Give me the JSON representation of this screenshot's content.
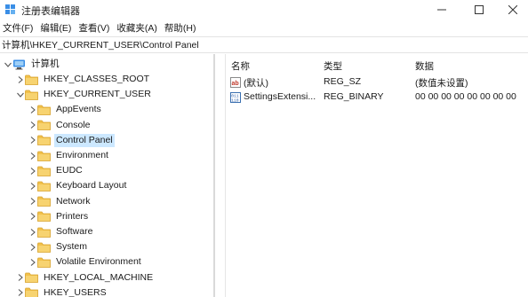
{
  "window": {
    "title": "注册表编辑器",
    "controls": {
      "minimize": "—",
      "maximize": "☐",
      "close": "✕"
    }
  },
  "menu": [
    "文件(F)",
    "编辑(E)",
    "查看(V)",
    "收藏夹(A)",
    "帮助(H)"
  ],
  "address": "计算机\\HKEY_CURRENT_USER\\Control Panel",
  "tree": {
    "root": "计算机",
    "items": [
      {
        "label": "HKEY_CLASSES_ROOT",
        "expanded": false
      },
      {
        "label": "HKEY_CURRENT_USER",
        "expanded": true
      },
      {
        "label": "AppEvents",
        "expanded": false
      },
      {
        "label": "Console",
        "expanded": false
      },
      {
        "label": "Control Panel",
        "expanded": false,
        "selected": true
      },
      {
        "label": "Environment",
        "expanded": false
      },
      {
        "label": "EUDC",
        "expanded": false
      },
      {
        "label": "Keyboard Layout",
        "expanded": false
      },
      {
        "label": "Network",
        "expanded": false
      },
      {
        "label": "Printers",
        "expanded": false
      },
      {
        "label": "Software",
        "expanded": false
      },
      {
        "label": "System",
        "expanded": false
      },
      {
        "label": "Volatile Environment",
        "expanded": false
      },
      {
        "label": "HKEY_LOCAL_MACHINE",
        "expanded": false
      },
      {
        "label": "HKEY_USERS",
        "expanded": false
      }
    ]
  },
  "values": {
    "columns": [
      "名称",
      "类型",
      "数据"
    ],
    "rows": [
      {
        "name": "(默认)",
        "type": "REG_SZ",
        "data": "(数值未设置)",
        "icon": "string-value-icon"
      },
      {
        "name": "SettingsExtensi...",
        "type": "REG_BINARY",
        "data": "00 00 00 00 00 00 00 00",
        "icon": "binary-value-icon"
      }
    ]
  },
  "colors": {
    "selection": "#cce8ff",
    "folder": "#f2c14b",
    "accent": "#0078d4"
  }
}
